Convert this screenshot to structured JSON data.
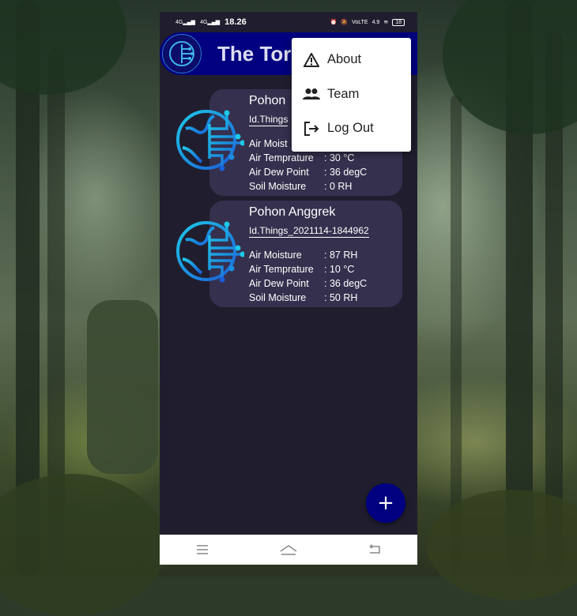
{
  "status_bar": {
    "network_1": "4G",
    "network_2": "4G",
    "time": "18.26",
    "speed": "4.9",
    "battery": "18"
  },
  "app_bar": {
    "title": "The Torr"
  },
  "overflow_menu": {
    "items": [
      {
        "label": "About",
        "icon": "warning-triangle-icon"
      },
      {
        "label": "Team",
        "icon": "people-icon"
      },
      {
        "label": "Log Out",
        "icon": "logout-icon"
      }
    ]
  },
  "cards": [
    {
      "name": "Pohon",
      "id": "Id.Things",
      "rows": [
        {
          "key": "Air Moist",
          "value": ""
        },
        {
          "key": "Air Temprature",
          "value": ": 30 °C"
        },
        {
          "key": "Air Dew Point",
          "value": ": 36 degC"
        },
        {
          "key": "Soil Moisture",
          "value": ": 0 RH"
        }
      ]
    },
    {
      "name": "Pohon Anggrek",
      "id": "Id.Things_2021114-1844962",
      "rows": [
        {
          "key": "Air Moisture",
          "value": ": 87 RH"
        },
        {
          "key": "Air Temprature",
          "value": ": 10 °C"
        },
        {
          "key": "Air Dew Point",
          "value": ": 36 degC"
        },
        {
          "key": "Soil Moisture",
          "value": ": 50 RH"
        }
      ]
    }
  ],
  "fab": {
    "label": "+"
  },
  "colors": {
    "primary": "#000080",
    "background": "#201e2e",
    "card": "#35304e",
    "icon_gradient_start": "#1ec8e8",
    "icon_gradient_end": "#1a5ed8"
  }
}
